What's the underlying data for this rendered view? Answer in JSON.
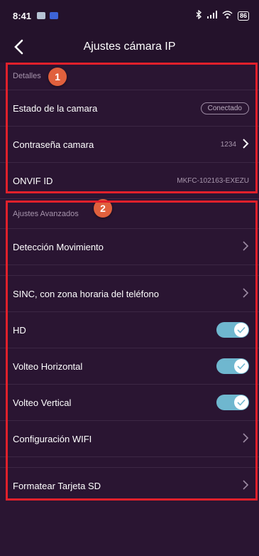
{
  "status_bar": {
    "time": "8:41",
    "battery": "86",
    "icons": [
      "app-notification-icon",
      "app-icon",
      "bluetooth-icon",
      "signal-icon",
      "wifi-icon",
      "battery-icon"
    ]
  },
  "navbar": {
    "title": "Ajustes cámara IP"
  },
  "section1": {
    "header": "Detalles",
    "badge": "1",
    "rows": [
      {
        "label": "Estado de la camara",
        "value": "Conectado"
      },
      {
        "label": "Contraseña camara",
        "value": "1234"
      },
      {
        "label": "ONVIF ID",
        "value": "MKFC-102163-EXEZU"
      }
    ]
  },
  "section2": {
    "header": "Ajustes Avanzados",
    "badge": "2",
    "items": [
      {
        "label": "Detección Movimiento"
      },
      {
        "label": "SINC, con zona horaria del teléfono"
      },
      {
        "label": "HD",
        "on": true
      },
      {
        "label": "Volteo Horizontal",
        "on": true
      },
      {
        "label": "Volteo Vertical",
        "on": true
      },
      {
        "label": "Configuración WIFI"
      },
      {
        "label": "Formatear Tarjeta SD"
      }
    ]
  },
  "colors": {
    "background": "#2a1532",
    "bar": "#24122b",
    "toggle_on": "#6fb7cf",
    "badge": "#e0603d",
    "highlight": "#e1202b"
  }
}
